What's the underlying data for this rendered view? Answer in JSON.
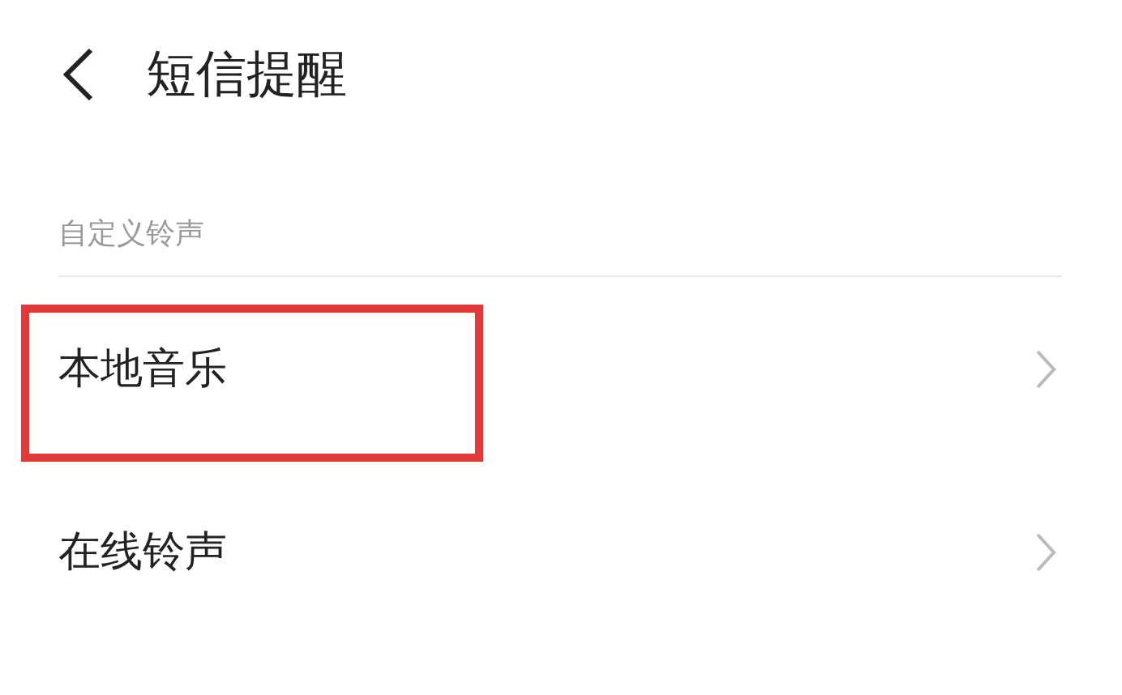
{
  "header": {
    "title": "短信提醒"
  },
  "section": {
    "label": "自定义铃声",
    "items": [
      {
        "label": "本地音乐",
        "highlighted": true
      },
      {
        "label": "在线铃声",
        "highlighted": false
      }
    ]
  }
}
